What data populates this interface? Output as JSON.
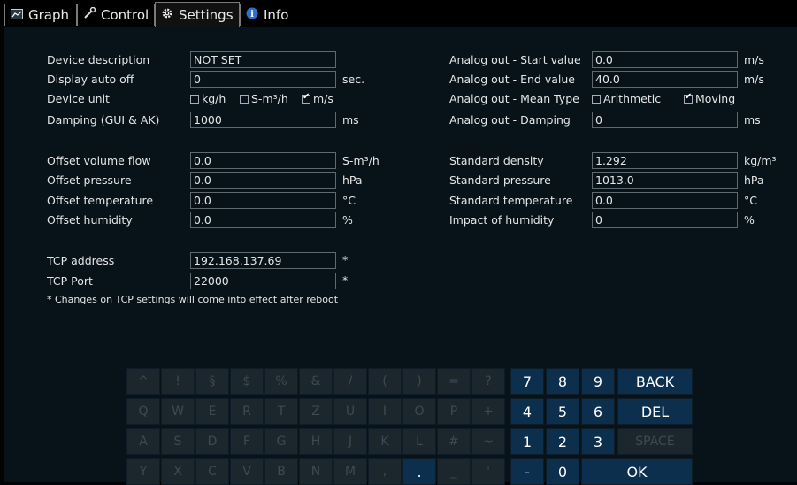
{
  "tabs": [
    {
      "label": "Graph"
    },
    {
      "label": "Control"
    },
    {
      "label": "Settings"
    },
    {
      "label": "Info"
    }
  ],
  "left": {
    "device_description": {
      "label": "Device description",
      "value": "NOT SET"
    },
    "display_auto_off": {
      "label": "Display auto off",
      "value": "0",
      "unit": "sec."
    },
    "device_unit": {
      "label": "Device unit",
      "options": [
        {
          "label": "kg/h",
          "checked": false
        },
        {
          "label": "S-m³/h",
          "checked": false
        },
        {
          "label": "m/s",
          "checked": true
        }
      ]
    },
    "damping": {
      "label": "Damping (GUI & AK)",
      "value": "1000",
      "unit": "ms"
    },
    "offset_volume_flow": {
      "label": "Offset volume flow",
      "value": "0.0",
      "unit": "S-m³/h"
    },
    "offset_pressure": {
      "label": "Offset pressure",
      "value": "0.0",
      "unit": "hPa"
    },
    "offset_temperature": {
      "label": "Offset temperature",
      "value": "0.0",
      "unit": "°C"
    },
    "offset_humidity": {
      "label": "Offset humidity",
      "value": "0.0",
      "unit": "%"
    },
    "tcp_address": {
      "label": "TCP address",
      "value": "192.168.137.69",
      "unit": "*"
    },
    "tcp_port": {
      "label": "TCP Port",
      "value": "22000",
      "unit": "*"
    },
    "note": "* Changes on TCP settings will come into effect after reboot"
  },
  "right": {
    "start_value": {
      "label": "Analog out - Start value",
      "value": "0.0",
      "unit": "m/s"
    },
    "end_value": {
      "label": "Analog out - End value",
      "value": "40.0",
      "unit": "m/s"
    },
    "mean_type": {
      "label": "Analog out - Mean Type",
      "options": [
        {
          "label": "Arithmetic",
          "checked": false
        },
        {
          "label": "Moving",
          "checked": true
        }
      ]
    },
    "analog_damping": {
      "label": "Analog out - Damping",
      "value": "0",
      "unit": "ms"
    },
    "std_density": {
      "label": "Standard density",
      "value": "1.292",
      "unit": "kg/m³"
    },
    "std_pressure": {
      "label": "Standard pressure",
      "value": "1013.0",
      "unit": "hPa"
    },
    "std_temperature": {
      "label": "Standard temperature",
      "value": "0.0",
      "unit": "°C"
    },
    "impact_humidity": {
      "label": "Impact of humidity",
      "value": "0",
      "unit": "%"
    }
  },
  "keyboard": {
    "row1": [
      "^",
      "!",
      "§",
      "$",
      "%",
      "&",
      "/",
      "(",
      ")",
      "=",
      "?"
    ],
    "row2": [
      "Q",
      "W",
      "E",
      "R",
      "T",
      "Z",
      "U",
      "I",
      "O",
      "P",
      "+"
    ],
    "row3": [
      "A",
      "S",
      "D",
      "F",
      "G",
      "H",
      "J",
      "K",
      "L",
      "#",
      "~"
    ],
    "row4": [
      "Y",
      "X",
      "C",
      "V",
      "B",
      "N",
      "M",
      ",",
      ".",
      "_",
      "'"
    ],
    "num1": [
      "7",
      "8",
      "9"
    ],
    "num2": [
      "4",
      "5",
      "6"
    ],
    "num3": [
      "1",
      "2",
      "3"
    ],
    "num4": [
      "-",
      "0"
    ],
    "back": "BACK",
    "del": "DEL",
    "space": "SPACE",
    "ok": "OK"
  }
}
